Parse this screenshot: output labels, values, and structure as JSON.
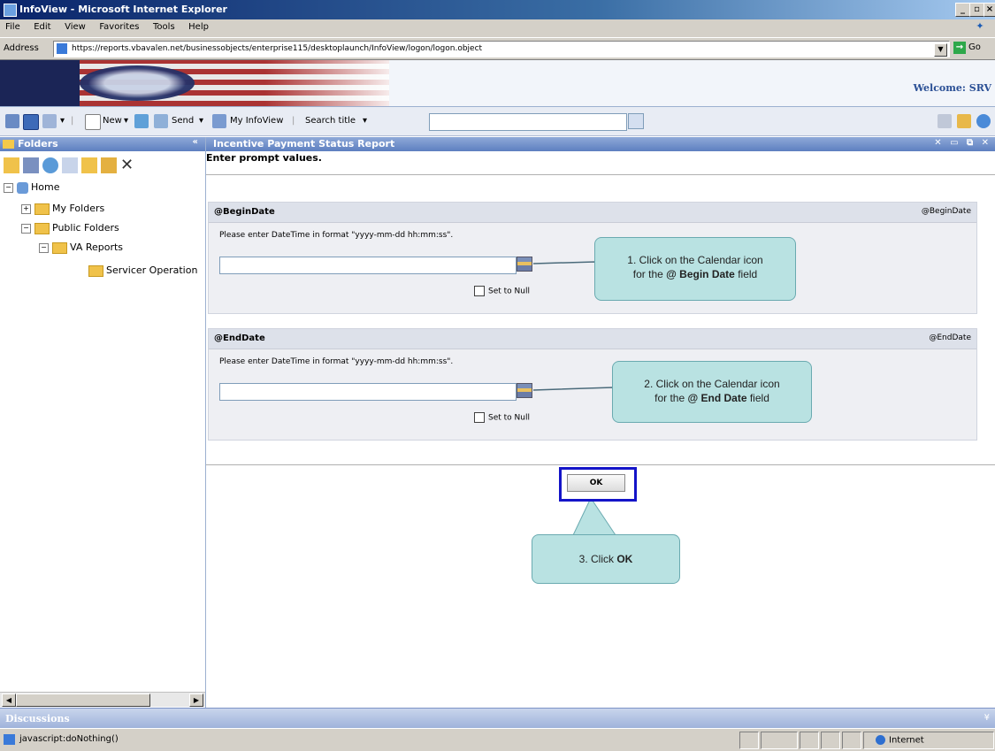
{
  "window": {
    "title": "InfoView - Microsoft Internet Explorer"
  },
  "menu": [
    "File",
    "Edit",
    "View",
    "Favorites",
    "Tools",
    "Help"
  ],
  "address": {
    "label": "Address",
    "url": "https://reports.vbavalen.net/businessobjects/enterprise115/desktoplaunch/InfoView/logon/logon.object",
    "go_label": "Go"
  },
  "banner": {
    "welcome": "Welcome: SRV"
  },
  "toolbar": {
    "new_label": "New",
    "send_label": "Send",
    "myinfoview_label": "My InfoView",
    "search_label": "Search title",
    "search_value": ""
  },
  "folders": {
    "header": "Folders",
    "tree": [
      {
        "label": "Home",
        "expander": "⊟"
      },
      {
        "label": "My Folders",
        "expander": "⊞"
      },
      {
        "label": "Public Folders",
        "expander": "⊟"
      },
      {
        "label": "VA Reports",
        "expander": "⊟"
      },
      {
        "label": "Servicer Operation",
        "expander": ""
      }
    ]
  },
  "report": {
    "title": "Incentive Payment Status Report",
    "prompt_heading": "Enter prompt values.",
    "sections": [
      {
        "label": "@BeginDate",
        "label_right": "@BeginDate",
        "instruction": "Please enter DateTime in format \"yyyy-mm-dd hh:mm:ss\".",
        "value": "",
        "null_label": "Set to Null"
      },
      {
        "label": "@EndDate",
        "label_right": "@EndDate",
        "instruction": "Please enter DateTime in format \"yyyy-mm-dd hh:mm:ss\".",
        "value": "",
        "null_label": "Set to Null"
      }
    ],
    "ok_label": "OK"
  },
  "callouts": {
    "c1_line1": "1. Click on the Calendar icon",
    "c1_pre": "for the ",
    "c1_bold": "@ Begin Date",
    "c1_post": " field",
    "c2_line1": "2. Click on the Calendar icon",
    "c2_pre": "for the ",
    "c2_bold": "@ End Date",
    "c2_post": " field",
    "c3_pre": "3. Click ",
    "c3_bold": "OK"
  },
  "discussions": {
    "label": "Discussions"
  },
  "status": {
    "text": "javascript:doNothing()",
    "zone": "Internet"
  },
  "colors": {
    "callout_bg": "#b9e2e2",
    "highlight_border": "#1414c8",
    "panel_header": "#5d7fc0"
  }
}
